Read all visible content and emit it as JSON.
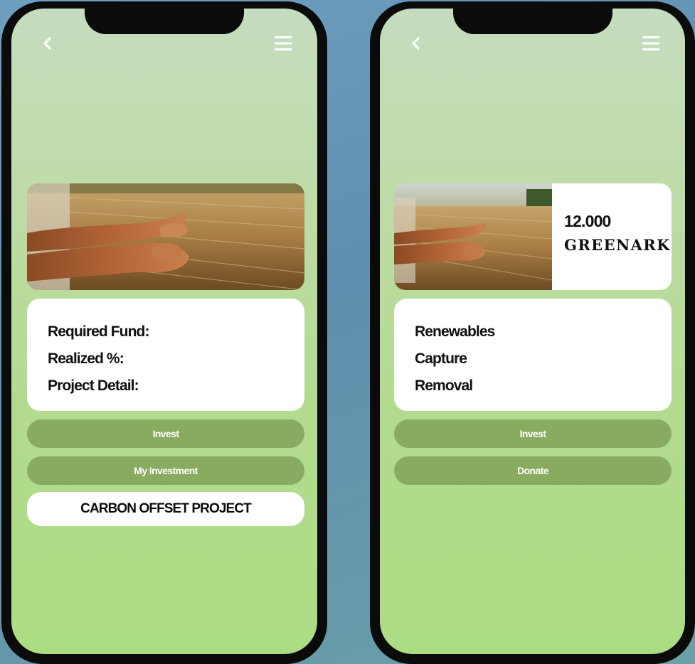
{
  "left_phone": {
    "info_card": {
      "required_fund_label": "Required Fund:",
      "realized_label": "Realized %:",
      "project_detail_label": "Project Detail:"
    },
    "buttons": {
      "invest": "Invest",
      "my_investment": "My Investment"
    },
    "project_title": "CARBON OFFSET PROJECT"
  },
  "right_phone": {
    "hero": {
      "amount": "12.000",
      "token_name": "GREENARK"
    },
    "categories": [
      "Renewables",
      "Capture",
      "Removal"
    ],
    "buttons": {
      "invest": "Invest",
      "donate": "Donate"
    }
  },
  "icons": [
    "back-icon",
    "menu-icon"
  ],
  "colors": {
    "button_green": "#88ab60",
    "screen_gradient_top": "#c5dcbf",
    "screen_gradient_bottom": "#acdc82",
    "phone_frame": "#0b0b0b"
  }
}
